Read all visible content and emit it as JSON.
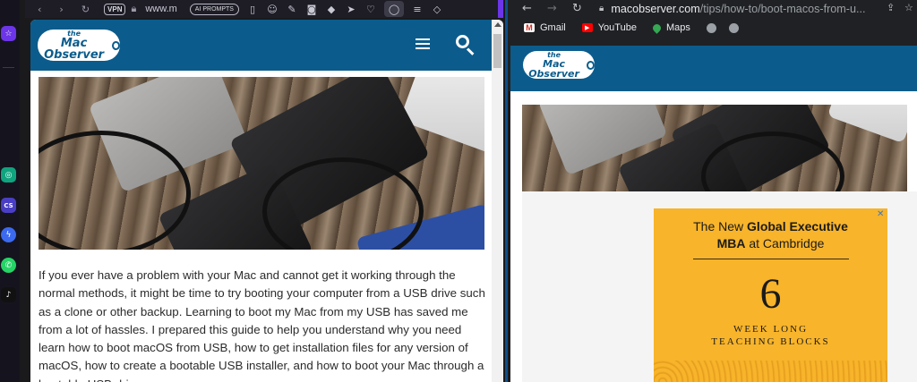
{
  "left_browser": {
    "vpn_label": "VPN",
    "url": "www.m",
    "ai_prompts_label": "AI PROMPTS",
    "site": {
      "logo_the": "the",
      "logo_text": "Mac Observer"
    },
    "article": {
      "paragraph": "If you ever have a problem with your Mac and cannot get it working through the normal methods, it might be time to try booting your computer from a USB drive such as a clone or other backup. Learning to boot my Mac from my USB has saved me from a lot of hassles. I prepared this guide to help you understand why you need learn how to boot macOS from USB, how to get installation files for any version of macOS, how to create a bootable USB installer, and how to boot your Mac through a bootable USB drive."
    }
  },
  "right_browser": {
    "url_host": "macobserver.com",
    "url_path": "/tips/how-to/boot-macos-from-u...",
    "bookmarks": [
      {
        "label": "Gmail",
        "icon": "gmail-icon"
      },
      {
        "label": "YouTube",
        "icon": "youtube-icon"
      },
      {
        "label": "Maps",
        "icon": "maps-icon"
      },
      {
        "label": "",
        "icon": "globe-icon"
      },
      {
        "label": "",
        "icon": "globe-icon"
      }
    ],
    "site": {
      "logo_the": "the",
      "logo_text": "Mac Observer"
    },
    "ad": {
      "line1_prefix": "The New ",
      "line1_bold": "Global Executive",
      "line2_bold": "MBA",
      "line2_suffix": " at Cambridge",
      "number": "6",
      "sub1": "WEEK LONG",
      "sub2": "TEACHING BLOCKS"
    }
  },
  "colors": {
    "site_header": "#0b5c8c",
    "ad_background": "#f8b42a",
    "opera_accent": "#6c35e8"
  }
}
